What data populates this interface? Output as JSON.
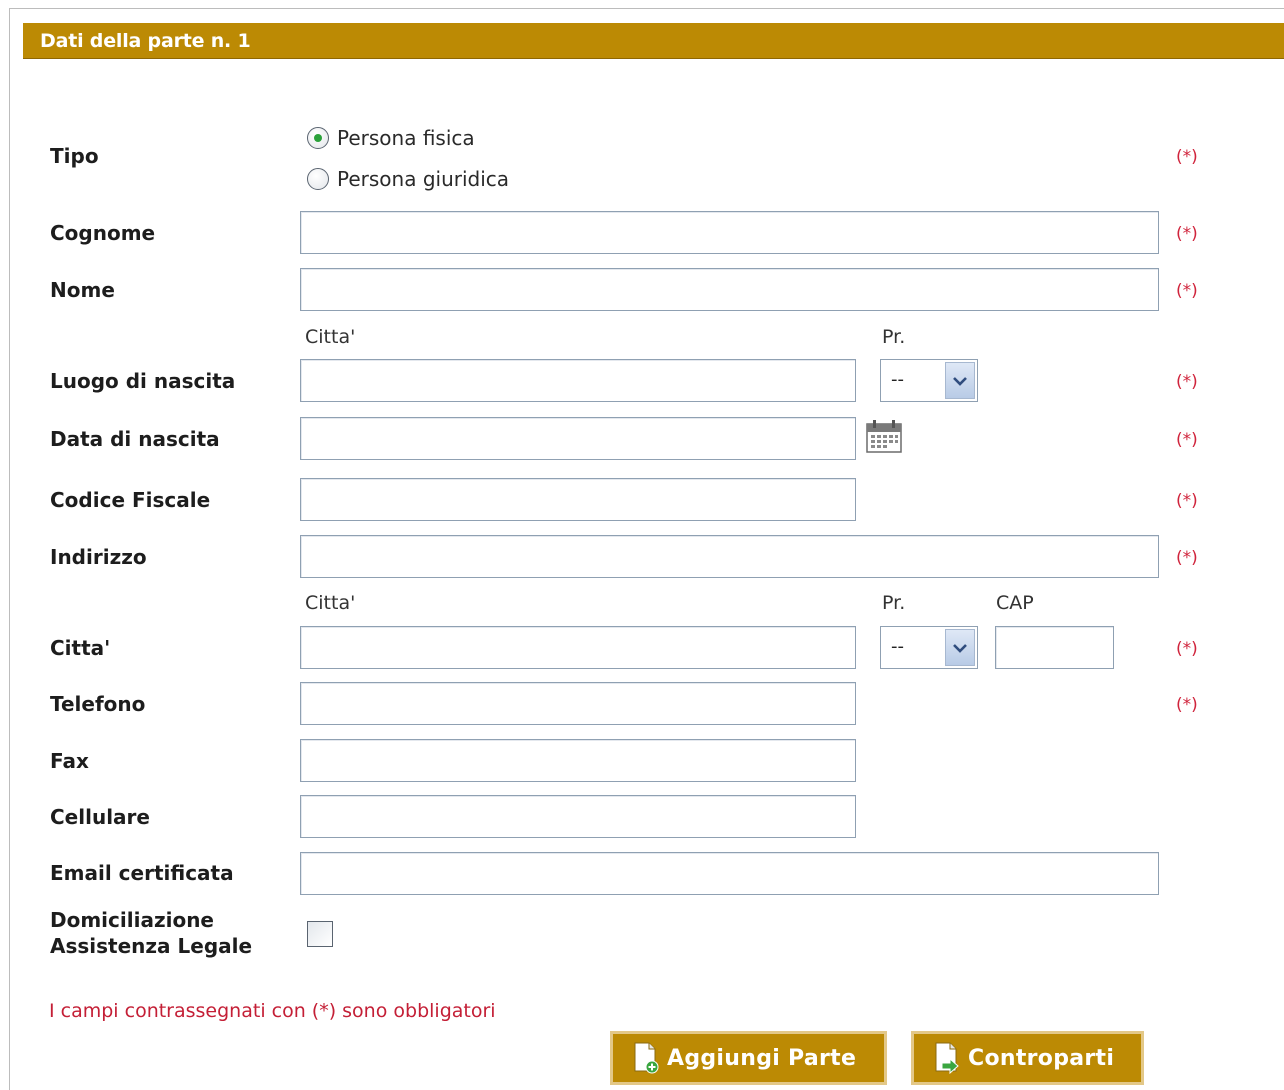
{
  "header": {
    "title": "Dati della parte n. 1"
  },
  "required_mark": "(*)",
  "form": {
    "tipo": {
      "label": "Tipo",
      "options": [
        {
          "label": "Persona fisica",
          "checked": true
        },
        {
          "label": "Persona giuridica",
          "checked": false
        }
      ]
    },
    "cognome": {
      "label": "Cognome",
      "value": ""
    },
    "nome": {
      "label": "Nome",
      "value": ""
    },
    "luogo_nascita": {
      "label": "Luogo di nascita",
      "city_header": "Citta'",
      "prov_header": "Pr.",
      "city_value": "",
      "prov_value": "--"
    },
    "data_nascita": {
      "label": "Data di nascita",
      "value": ""
    },
    "codice_fiscale": {
      "label": "Codice Fiscale",
      "value": ""
    },
    "indirizzo": {
      "label": "Indirizzo",
      "value": ""
    },
    "citta": {
      "label": "Citta'",
      "city_header": "Citta'",
      "prov_header": "Pr.",
      "cap_header": "CAP",
      "city_value": "",
      "prov_value": "--",
      "cap_value": ""
    },
    "telefono": {
      "label": "Telefono",
      "value": ""
    },
    "fax": {
      "label": "Fax",
      "value": ""
    },
    "cellulare": {
      "label": "Cellulare",
      "value": ""
    },
    "email": {
      "label": "Email certificata",
      "value": ""
    },
    "domiciliazione": {
      "label_line1": "Domiciliazione",
      "label_line2": "Assistenza Legale",
      "checked": false
    }
  },
  "note": "I campi contrassegnati con (*) sono obbligatori",
  "buttons": {
    "add_party": "Aggiungi Parte",
    "counterparts": "Controparti"
  },
  "colors": {
    "header_bg": "#bc8a04",
    "required": "#d0243c",
    "button_bg": "#bc8a04"
  }
}
